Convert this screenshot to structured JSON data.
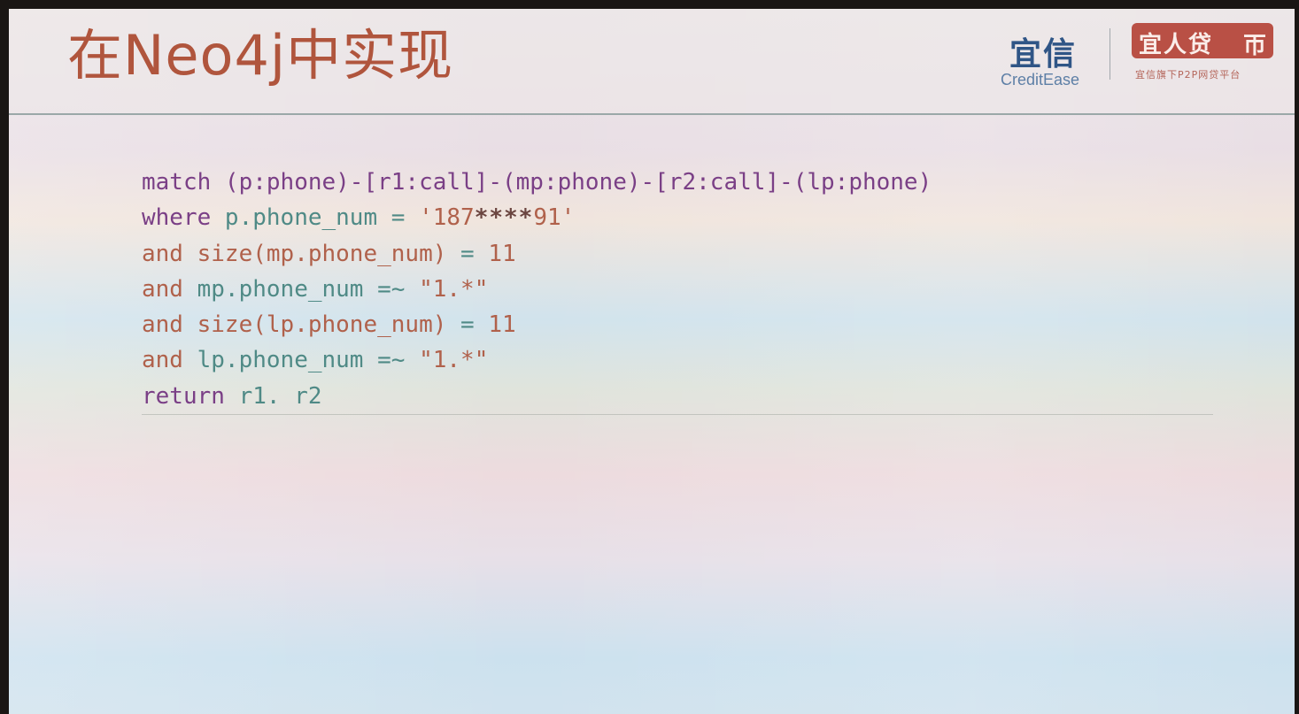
{
  "slide": {
    "title": "在Neo4j中实现",
    "logos": {
      "creditease_cn": "宜信",
      "creditease_en": "CreditEase",
      "yirendai_cn": "宜人贷",
      "yirendai_mark": "帀",
      "yirendai_sub": "宜信旗下P2P网贷平台"
    },
    "code": [
      {
        "parts": [
          {
            "t": "match ",
            "c": "kw"
          },
          {
            "t": "(p:phone)-[r1:call]-(mp:phone)-[r2:call]-(lp:phone)",
            "c": "kw"
          }
        ]
      },
      {
        "parts": [
          {
            "t": "where ",
            "c": "kw"
          },
          {
            "t": "p.phone_num = ",
            "c": "gr"
          },
          {
            "t": "'187",
            "c": "nm"
          },
          {
            "t": "****",
            "c": "mask"
          },
          {
            "t": "91'",
            "c": "nm"
          }
        ]
      },
      {
        "parts": [
          {
            "t": "and ",
            "c": "pt"
          },
          {
            "t": "size(mp.phone_num)",
            "c": "pt"
          },
          {
            "t": " = ",
            "c": "gr"
          },
          {
            "t": "11",
            "c": "nm"
          }
        ]
      },
      {
        "parts": [
          {
            "t": "and ",
            "c": "pt"
          },
          {
            "t": "mp.phone_num =~ ",
            "c": "gr"
          },
          {
            "t": "\"1.*\"",
            "c": "nm"
          }
        ]
      },
      {
        "parts": [
          {
            "t": "and ",
            "c": "pt"
          },
          {
            "t": "size(lp.phone_num)",
            "c": "pt"
          },
          {
            "t": " = ",
            "c": "gr"
          },
          {
            "t": "11",
            "c": "nm"
          }
        ]
      },
      {
        "parts": [
          {
            "t": "and ",
            "c": "pt"
          },
          {
            "t": "lp.phone_num =~ ",
            "c": "gr"
          },
          {
            "t": "\"1.*\"",
            "c": "nm"
          }
        ]
      },
      {
        "parts": [
          {
            "t": "return ",
            "c": "kw"
          },
          {
            "t": "r1. r2",
            "c": "gr"
          }
        ]
      }
    ],
    "colors": {
      "title": "#b0553d",
      "keyword": "#7a3f86",
      "property": "#4f8a86",
      "literal": "#b0614b",
      "brand_blue": "#2f5586",
      "brand_red": "#b95045"
    }
  }
}
